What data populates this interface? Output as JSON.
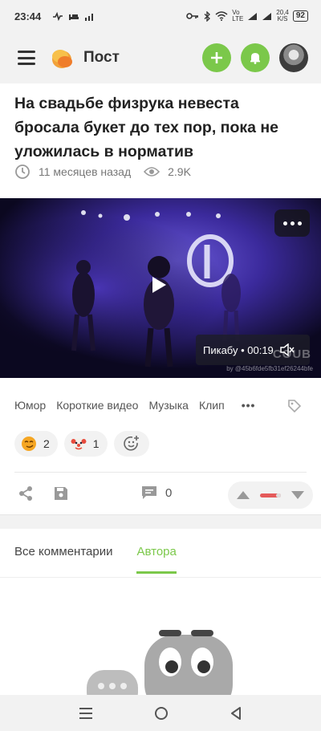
{
  "status": {
    "time": "23:44",
    "net_speed": "20,4",
    "net_unit": "K/S",
    "battery": "92",
    "lte_top": "Vo",
    "lte_bottom": "LTE"
  },
  "appbar": {
    "title": "Пост"
  },
  "post": {
    "title": "На свадьбе физрука невеста бросала букет до тех пор, пока не уложилась в норматив",
    "time_ago": "11 месяцев назад",
    "views": "2.9K",
    "video": {
      "source_label": "Пикабу • 00:19",
      "watermark": "COUB",
      "watermark_by": "by @45b6fde5fb31ef26244bfe"
    },
    "tags": [
      "Юмор",
      "Короткие видео",
      "Музыка",
      "Клип"
    ],
    "tags_more": "•••",
    "reactions": [
      {
        "icon": "smirk-emoji-icon",
        "count": "2"
      },
      {
        "icon": "clown-emoji-icon",
        "count": "1"
      }
    ],
    "comments_count": "0",
    "rating_fill_fraction": 0.8
  },
  "comments": {
    "tabs": [
      "Все комментарии",
      "Автора"
    ],
    "active_tab": 1
  },
  "colors": {
    "accent": "#7bc84a",
    "rating_negative": "#e45a5a"
  }
}
